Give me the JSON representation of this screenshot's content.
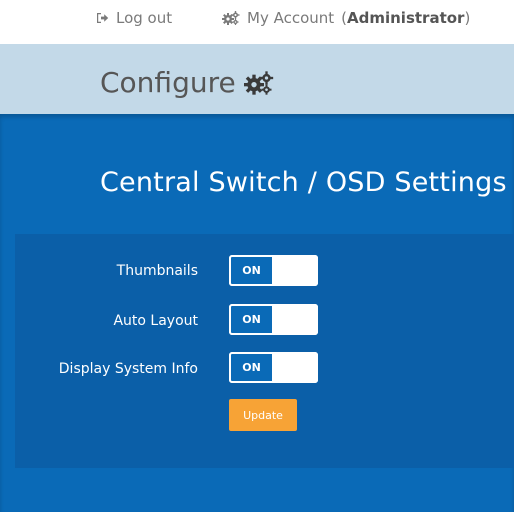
{
  "topbar": {
    "logout_label": "Log out",
    "account_label": "My Account",
    "account_open_paren": "(",
    "account_role": "Administrator",
    "account_close_paren": ")"
  },
  "header": {
    "title": "Configure"
  },
  "main": {
    "title": "Central Switch / OSD Settings",
    "settings": [
      {
        "label": "Thumbnails",
        "state": "ON"
      },
      {
        "label": "Auto Layout",
        "state": "ON"
      },
      {
        "label": "Display System Info",
        "state": "ON"
      }
    ],
    "update_label": "Update"
  },
  "colors": {
    "panel_blue": "#0a6ab7",
    "card_blue": "#0b5fa8",
    "band_light_blue": "#c3d9e8",
    "update_orange": "#f7a336"
  },
  "icons": {
    "logout": "sign-out-icon",
    "account": "gears-icon",
    "configure": "gears-icon"
  }
}
